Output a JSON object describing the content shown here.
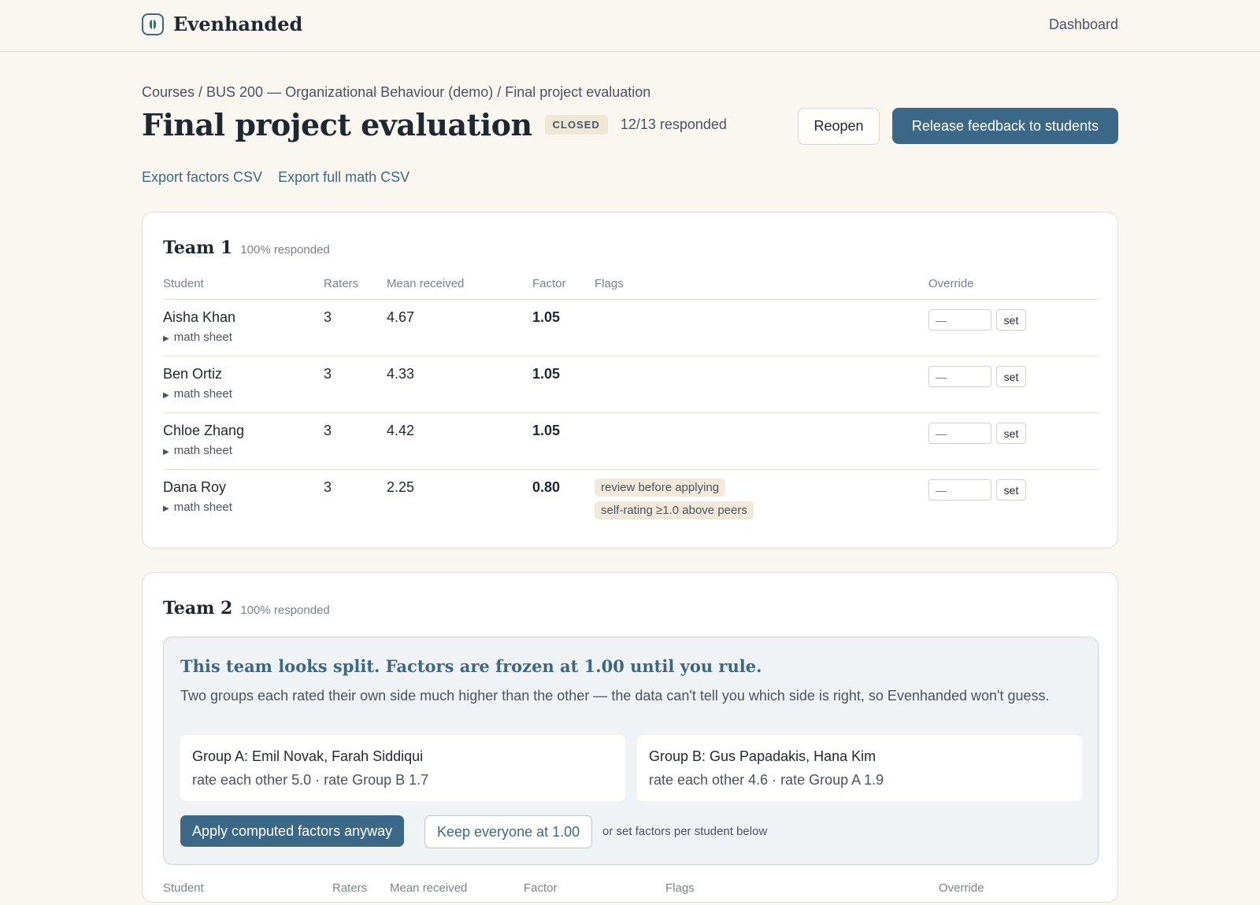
{
  "app": {
    "name": "Evenhanded",
    "nav_dashboard": "Dashboard"
  },
  "breadcrumb": "Courses / BUS 200 — Organizational Behaviour (demo) / Final project evaluation",
  "page": {
    "title": "Final project evaluation",
    "status_badge": "CLOSED",
    "responded": "12/13 responded",
    "reopen_label": "Reopen",
    "release_label": "Release feedback to students"
  },
  "exports": {
    "factors_csv": "Export factors CSV",
    "full_math_csv": "Export full math CSV"
  },
  "columns": {
    "student": "Student",
    "raters": "Raters",
    "mean": "Mean received",
    "factor": "Factor",
    "flags": "Flags",
    "override": "Override"
  },
  "override": {
    "placeholder": "—",
    "set_label": "set"
  },
  "math_sheet_label": "math sheet",
  "team1": {
    "name": "Team 1",
    "pct": "100% responded",
    "rows": [
      {
        "student": "Aisha Khan",
        "raters": "3",
        "mean": "4.67",
        "factor": "1.05",
        "flags": []
      },
      {
        "student": "Ben Ortiz",
        "raters": "3",
        "mean": "4.33",
        "factor": "1.05",
        "flags": []
      },
      {
        "student": "Chloe Zhang",
        "raters": "3",
        "mean": "4.42",
        "factor": "1.05",
        "flags": []
      },
      {
        "student": "Dana Roy",
        "raters": "3",
        "mean": "2.25",
        "factor": "0.80",
        "flags": [
          "review before applying",
          "self-rating ≥1.0 above peers"
        ]
      }
    ]
  },
  "team2": {
    "name": "Team 2",
    "pct": "100% responded",
    "split": {
      "title": "This team looks split. Factors are frozen at 1.00 until you rule.",
      "description": "Two groups each rated their own side much higher than the other — the data can't tell you which side is right, so Evenhanded won't guess.",
      "group_a": {
        "title": "Group A: Emil Novak, Farah Siddiqui",
        "stats": "rate each other 5.0 · rate Group B 1.7"
      },
      "group_b": {
        "title": "Group B: Gus Papadakis, Hana Kim",
        "stats": "rate each other 4.6 · rate Group A 1.9"
      },
      "apply_label": "Apply computed factors anyway",
      "keep_label": "Keep everyone at 1.00",
      "or_note": "or set factors per student below"
    }
  },
  "colors": {
    "accent": "#3c6888",
    "background": "#faf6f0",
    "flag_bg": "#f2e9da"
  }
}
